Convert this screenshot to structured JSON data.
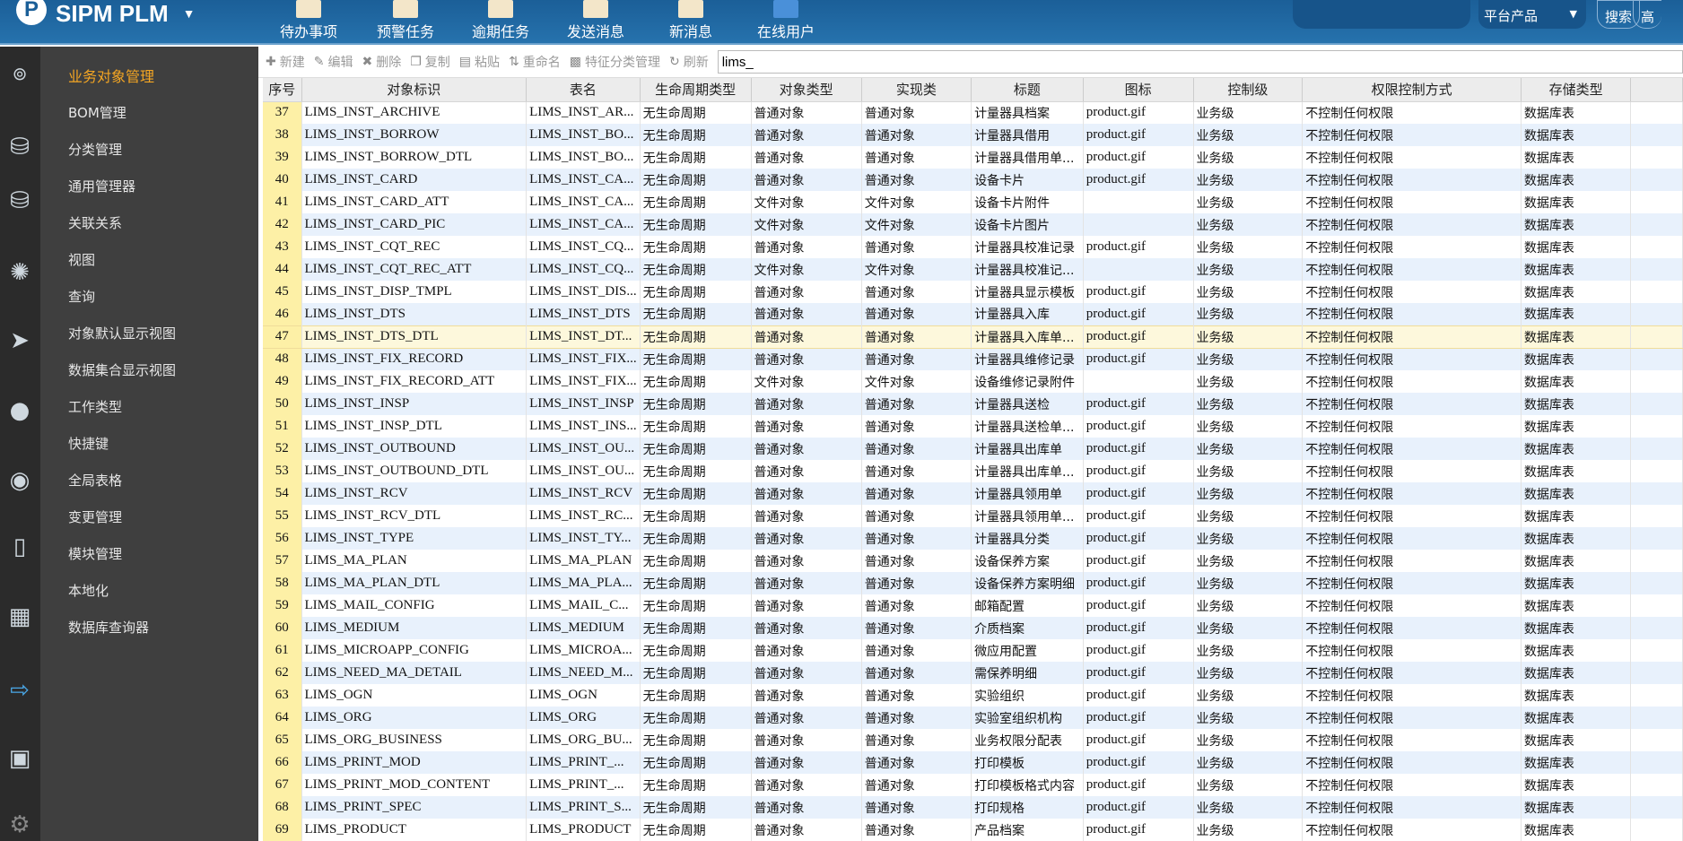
{
  "app": {
    "title": "SIPM PLM",
    "logo_letter": "P"
  },
  "nav": [
    {
      "label": "待办事项",
      "icon": "todo-icon"
    },
    {
      "label": "预警任务",
      "icon": "warning-icon"
    },
    {
      "label": "逾期任务",
      "icon": "clock-icon"
    },
    {
      "label": "发送消息",
      "icon": "send-mail-icon"
    },
    {
      "label": "新消息",
      "icon": "inbox-icon"
    },
    {
      "label": "在线用户",
      "icon": "users-icon"
    }
  ],
  "search": {
    "value": "",
    "scope": "平台产品",
    "search_label": "搜索",
    "advanced_label": "高"
  },
  "sidebar": {
    "items": [
      {
        "label": "业务对象管理",
        "active": true
      },
      {
        "label": "BOM管理"
      },
      {
        "label": "分类管理"
      },
      {
        "label": "通用管理器"
      },
      {
        "label": "关联关系"
      },
      {
        "label": "视图"
      },
      {
        "label": "查询"
      },
      {
        "label": "对象默认显示视图"
      },
      {
        "label": "数据集合显示视图"
      },
      {
        "label": "工作类型"
      },
      {
        "label": "快捷键"
      },
      {
        "label": "全局表格"
      },
      {
        "label": "变更管理"
      },
      {
        "label": "模块管理"
      },
      {
        "label": "本地化"
      },
      {
        "label": "数据库查询器"
      }
    ]
  },
  "toolbar": {
    "new": "新建",
    "edit": "编辑",
    "delete": "删除",
    "copy": "复制",
    "paste": "粘贴",
    "rename": "重命名",
    "feature": "特征分类管理",
    "refresh": "刷新",
    "filter_value": "lims_"
  },
  "table": {
    "columns": [
      "序号",
      "对象标识",
      "表名",
      "生命周期类型",
      "对象类型",
      "实现类",
      "标题",
      "图标",
      "控制级",
      "权限控制方式",
      "存储类型",
      ""
    ],
    "selected_row": "47",
    "rows": [
      [
        "37",
        "LIMS_INST_ARCHIVE",
        "LIMS_INST_AR...",
        "无生命周期",
        "普通对象",
        "普通对象",
        "计量器具档案",
        "product.gif",
        "业务级",
        "不控制任何权限",
        "数据库表"
      ],
      [
        "38",
        "LIMS_INST_BORROW",
        "LIMS_INST_BO...",
        "无生命周期",
        "普通对象",
        "普通对象",
        "计量器具借用",
        "product.gif",
        "业务级",
        "不控制任何权限",
        "数据库表"
      ],
      [
        "39",
        "LIMS_INST_BORROW_DTL",
        "LIMS_INST_BO...",
        "无生命周期",
        "普通对象",
        "普通对象",
        "计量器具借用单...",
        "product.gif",
        "业务级",
        "不控制任何权限",
        "数据库表"
      ],
      [
        "40",
        "LIMS_INST_CARD",
        "LIMS_INST_CA...",
        "无生命周期",
        "普通对象",
        "普通对象",
        "设备卡片",
        "product.gif",
        "业务级",
        "不控制任何权限",
        "数据库表"
      ],
      [
        "41",
        "LIMS_INST_CARD_ATT",
        "LIMS_INST_CA...",
        "无生命周期",
        "文件对象",
        "文件对象",
        "设备卡片附件",
        "",
        "业务级",
        "不控制任何权限",
        "数据库表"
      ],
      [
        "42",
        "LIMS_INST_CARD_PIC",
        "LIMS_INST_CA...",
        "无生命周期",
        "文件对象",
        "文件对象",
        "设备卡片图片",
        "",
        "业务级",
        "不控制任何权限",
        "数据库表"
      ],
      [
        "43",
        "LIMS_INST_CQT_REC",
        "LIMS_INST_CQ...",
        "无生命周期",
        "普通对象",
        "普通对象",
        "计量器具校准记录",
        "product.gif",
        "业务级",
        "不控制任何权限",
        "数据库表"
      ],
      [
        "44",
        "LIMS_INST_CQT_REC_ATT",
        "LIMS_INST_CQ...",
        "无生命周期",
        "文件对象",
        "文件对象",
        "计量器具校准记...",
        "",
        "业务级",
        "不控制任何权限",
        "数据库表"
      ],
      [
        "45",
        "LIMS_INST_DISP_TMPL",
        "LIMS_INST_DIS...",
        "无生命周期",
        "普通对象",
        "普通对象",
        "计量器具显示模板",
        "product.gif",
        "业务级",
        "不控制任何权限",
        "数据库表"
      ],
      [
        "46",
        "LIMS_INST_DTS",
        "LIMS_INST_DTS",
        "无生命周期",
        "普通对象",
        "普通对象",
        "计量器具入库",
        "product.gif",
        "业务级",
        "不控制任何权限",
        "数据库表"
      ],
      [
        "47",
        "LIMS_INST_DTS_DTL",
        "LIMS_INST_DT...",
        "无生命周期",
        "普通对象",
        "普通对象",
        "计量器具入库单...",
        "product.gif",
        "业务级",
        "不控制任何权限",
        "数据库表"
      ],
      [
        "48",
        "LIMS_INST_FIX_RECORD",
        "LIMS_INST_FIX...",
        "无生命周期",
        "普通对象",
        "普通对象",
        "计量器具维修记录",
        "product.gif",
        "业务级",
        "不控制任何权限",
        "数据库表"
      ],
      [
        "49",
        "LIMS_INST_FIX_RECORD_ATT",
        "LIMS_INST_FIX...",
        "无生命周期",
        "文件对象",
        "文件对象",
        "设备维修记录附件",
        "",
        "业务级",
        "不控制任何权限",
        "数据库表"
      ],
      [
        "50",
        "LIMS_INST_INSP",
        "LIMS_INST_INSP",
        "无生命周期",
        "普通对象",
        "普通对象",
        "计量器具送检",
        "product.gif",
        "业务级",
        "不控制任何权限",
        "数据库表"
      ],
      [
        "51",
        "LIMS_INST_INSP_DTL",
        "LIMS_INST_INS...",
        "无生命周期",
        "普通对象",
        "普通对象",
        "计量器具送检单...",
        "product.gif",
        "业务级",
        "不控制任何权限",
        "数据库表"
      ],
      [
        "52",
        "LIMS_INST_OUTBOUND",
        "LIMS_INST_OU...",
        "无生命周期",
        "普通对象",
        "普通对象",
        "计量器具出库单",
        "product.gif",
        "业务级",
        "不控制任何权限",
        "数据库表"
      ],
      [
        "53",
        "LIMS_INST_OUTBOUND_DTL",
        "LIMS_INST_OU...",
        "无生命周期",
        "普通对象",
        "普通对象",
        "计量器具出库单...",
        "product.gif",
        "业务级",
        "不控制任何权限",
        "数据库表"
      ],
      [
        "54",
        "LIMS_INST_RCV",
        "LIMS_INST_RCV",
        "无生命周期",
        "普通对象",
        "普通对象",
        "计量器具领用单",
        "product.gif",
        "业务级",
        "不控制任何权限",
        "数据库表"
      ],
      [
        "55",
        "LIMS_INST_RCV_DTL",
        "LIMS_INST_RC...",
        "无生命周期",
        "普通对象",
        "普通对象",
        "计量器具领用单...",
        "product.gif",
        "业务级",
        "不控制任何权限",
        "数据库表"
      ],
      [
        "56",
        "LIMS_INST_TYPE",
        "LIMS_INST_TY...",
        "无生命周期",
        "普通对象",
        "普通对象",
        "计量器具分类",
        "product.gif",
        "业务级",
        "不控制任何权限",
        "数据库表"
      ],
      [
        "57",
        "LIMS_MA_PLAN",
        "LIMS_MA_PLAN",
        "无生命周期",
        "普通对象",
        "普通对象",
        "设备保养方案",
        "product.gif",
        "业务级",
        "不控制任何权限",
        "数据库表"
      ],
      [
        "58",
        "LIMS_MA_PLAN_DTL",
        "LIMS_MA_PLA...",
        "无生命周期",
        "普通对象",
        "普通对象",
        "设备保养方案明细",
        "product.gif",
        "业务级",
        "不控制任何权限",
        "数据库表"
      ],
      [
        "59",
        "LIMS_MAIL_CONFIG",
        "LIMS_MAIL_C...",
        "无生命周期",
        "普通对象",
        "普通对象",
        "邮箱配置",
        "product.gif",
        "业务级",
        "不控制任何权限",
        "数据库表"
      ],
      [
        "60",
        "LIMS_MEDIUM",
        "LIMS_MEDIUM",
        "无生命周期",
        "普通对象",
        "普通对象",
        "介质档案",
        "product.gif",
        "业务级",
        "不控制任何权限",
        "数据库表"
      ],
      [
        "61",
        "LIMS_MICROAPP_CONFIG",
        "LIMS_MICROA...",
        "无生命周期",
        "普通对象",
        "普通对象",
        "微应用配置",
        "product.gif",
        "业务级",
        "不控制任何权限",
        "数据库表"
      ],
      [
        "62",
        "LIMS_NEED_MA_DETAIL",
        "LIMS_NEED_M...",
        "无生命周期",
        "普通对象",
        "普通对象",
        "需保养明细",
        "product.gif",
        "业务级",
        "不控制任何权限",
        "数据库表"
      ],
      [
        "63",
        "LIMS_OGN",
        "LIMS_OGN",
        "无生命周期",
        "普通对象",
        "普通对象",
        "实验组织",
        "product.gif",
        "业务级",
        "不控制任何权限",
        "数据库表"
      ],
      [
        "64",
        "LIMS_ORG",
        "LIMS_ORG",
        "无生命周期",
        "普通对象",
        "普通对象",
        "实验室组织机构",
        "product.gif",
        "业务级",
        "不控制任何权限",
        "数据库表"
      ],
      [
        "65",
        "LIMS_ORG_BUSINESS",
        "LIMS_ORG_BU...",
        "无生命周期",
        "普通对象",
        "普通对象",
        "业务权限分配表",
        "product.gif",
        "业务级",
        "不控制任何权限",
        "数据库表"
      ],
      [
        "66",
        "LIMS_PRINT_MOD",
        "LIMS_PRINT_...",
        "无生命周期",
        "普通对象",
        "普通对象",
        "打印模板",
        "product.gif",
        "业务级",
        "不控制任何权限",
        "数据库表"
      ],
      [
        "67",
        "LIMS_PRINT_MOD_CONTENT",
        "LIMS_PRINT_...",
        "无生命周期",
        "普通对象",
        "普通对象",
        "打印模板格式内容",
        "product.gif",
        "业务级",
        "不控制任何权限",
        "数据库表"
      ],
      [
        "68",
        "LIMS_PRINT_SPEC",
        "LIMS_PRINT_S...",
        "无生命周期",
        "普通对象",
        "普通对象",
        "打印规格",
        "product.gif",
        "业务级",
        "不控制任何权限",
        "数据库表"
      ],
      [
        "69",
        "LIMS_PRODUCT",
        "LIMS_PRODUCT",
        "无生命周期",
        "普通对象",
        "普通对象",
        "产品档案",
        "product.gif",
        "业务级",
        "不控制任何权限",
        "数据库表"
      ]
    ]
  }
}
